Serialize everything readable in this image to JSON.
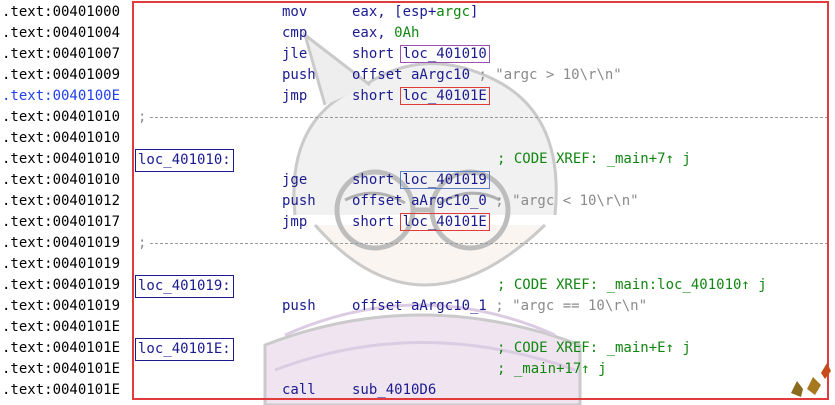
{
  "rows": [
    {
      "addr": ".text:00401000",
      "mnemonic": "mov",
      "operand_pre": "eax, [esp+",
      "operand_arg": "argc",
      "operand_post": "]"
    },
    {
      "addr": ".text:00401004",
      "mnemonic": "cmp",
      "operand_pre": "eax, ",
      "operand_num": "0Ah"
    },
    {
      "addr": ".text:00401007",
      "mnemonic": "jle",
      "operand_pre": "short ",
      "operand_box": "loc_401010"
    },
    {
      "addr": ".text:00401009",
      "mnemonic": "push",
      "operand_pre": "offset aArgc10",
      "comment": "; \"argc > 10\\r\\n\""
    },
    {
      "addr": ".text:0040100E",
      "mnemonic": "jmp",
      "operand_pre": "short ",
      "operand_box": "loc_40101E"
    },
    {
      "addr": ".text:00401010",
      "separator": ";"
    },
    {
      "addr": ".text:00401010"
    },
    {
      "addr": ".text:00401010",
      "label": "loc_401010:",
      "xref": "; CODE XREF: _main+7↑ j"
    },
    {
      "addr": ".text:00401010",
      "mnemonic": "jge",
      "operand_pre": "short ",
      "operand_box": "loc_401019"
    },
    {
      "addr": ".text:00401012",
      "mnemonic": "push",
      "operand_pre": "offset aArgc10_0",
      "comment": "; \"argc < 10\\r\\n\""
    },
    {
      "addr": ".text:00401017",
      "mnemonic": "jmp",
      "operand_pre": "short ",
      "operand_box": "loc_40101E"
    },
    {
      "addr": ".text:00401019",
      "separator": ";"
    },
    {
      "addr": ".text:00401019"
    },
    {
      "addr": ".text:00401019",
      "label": "loc_401019:",
      "xref": "; CODE XREF: _main:loc_401010↑ j"
    },
    {
      "addr": ".text:00401019",
      "mnemonic": "push",
      "operand_pre": "offset aArgc10_1",
      "comment": "; \"argc == 10\\r\\n\""
    },
    {
      "addr": ".text:0040101E"
    },
    {
      "addr": ".text:0040101E",
      "label": "loc_40101E:",
      "xref": "; CODE XREF: _main+E↑ j"
    },
    {
      "addr": ".text:0040101E",
      "xref": "; _main+17↑ j"
    },
    {
      "addr": ".text:0040101E",
      "mnemonic": "call",
      "operand_pre": "sub_4010D6"
    }
  ],
  "colors": {
    "frame": "#e23b3b",
    "purple": "#9b4fb7",
    "red": "#e23b3b",
    "blue": "#5b7fc6",
    "highlight_addr": "#1f3ff0",
    "xref": "#118611"
  }
}
